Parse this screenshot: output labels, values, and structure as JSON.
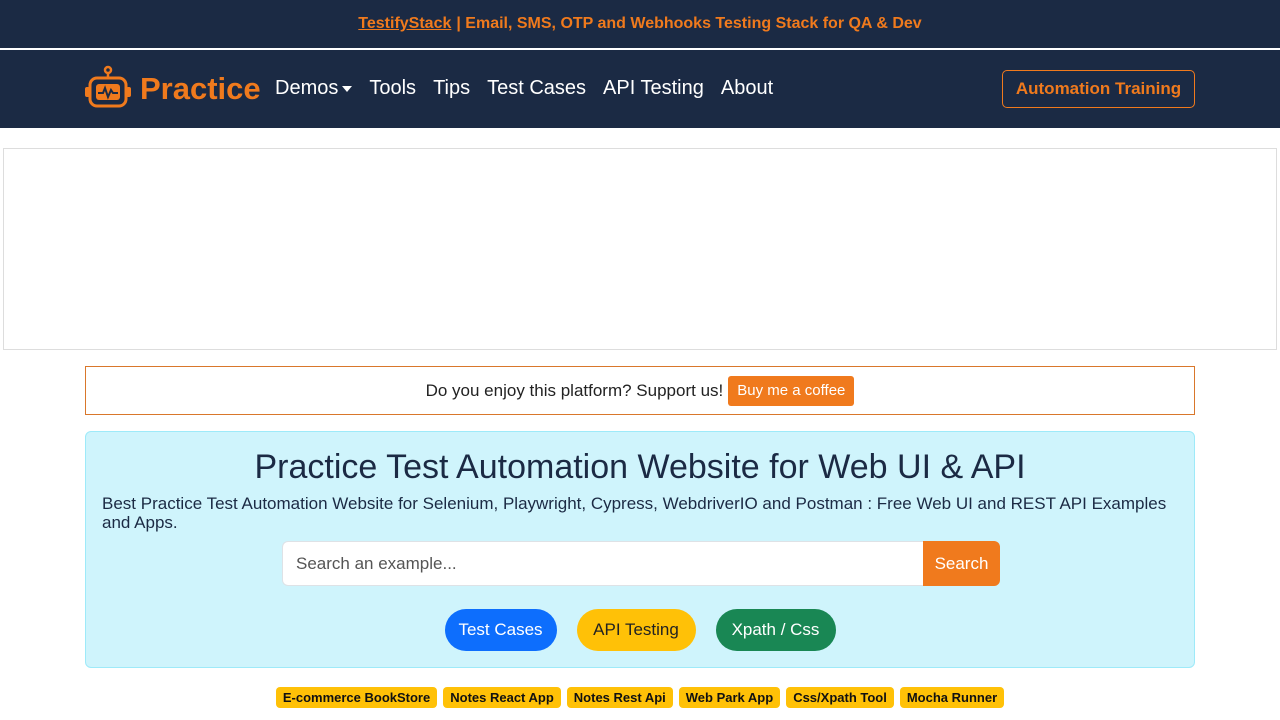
{
  "promo": {
    "link_text": "TestifyStack",
    "text": "| Email, SMS, OTP and Webhooks Testing Stack for QA & Dev"
  },
  "navbar": {
    "brand": "Practice",
    "brand_icon": "robot-icon",
    "links": [
      "Demos",
      "Tools",
      "Tips",
      "Test Cases",
      "API Testing",
      "About"
    ],
    "cta": "Automation Training"
  },
  "support": {
    "text": "Do you enjoy this platform? Support us!",
    "button": "Buy me a coffee"
  },
  "hero": {
    "title": "Practice Test Automation Website for Web UI & API",
    "subtitle": "Best Practice Test Automation Website for Selenium, Playwright, Cypress, WebdriverIO and Postman : Free Web UI and REST API Examples and Apps.",
    "search_placeholder": "Search an example...",
    "search_button": "Search",
    "pills": [
      "Test Cases",
      "API Testing",
      "Xpath / Css"
    ]
  },
  "tags": [
    "E-commerce BookStore",
    "Notes React App",
    "Notes Rest Api",
    "Web Park App",
    "Css/Xpath Tool",
    "Mocha Runner"
  ],
  "colors": {
    "navy": "#1b2a44",
    "accent": "#f07a1d",
    "hero_bg": "#cff4fc",
    "blue": "#0d6efd",
    "yellow": "#ffc107",
    "green": "#198754"
  }
}
